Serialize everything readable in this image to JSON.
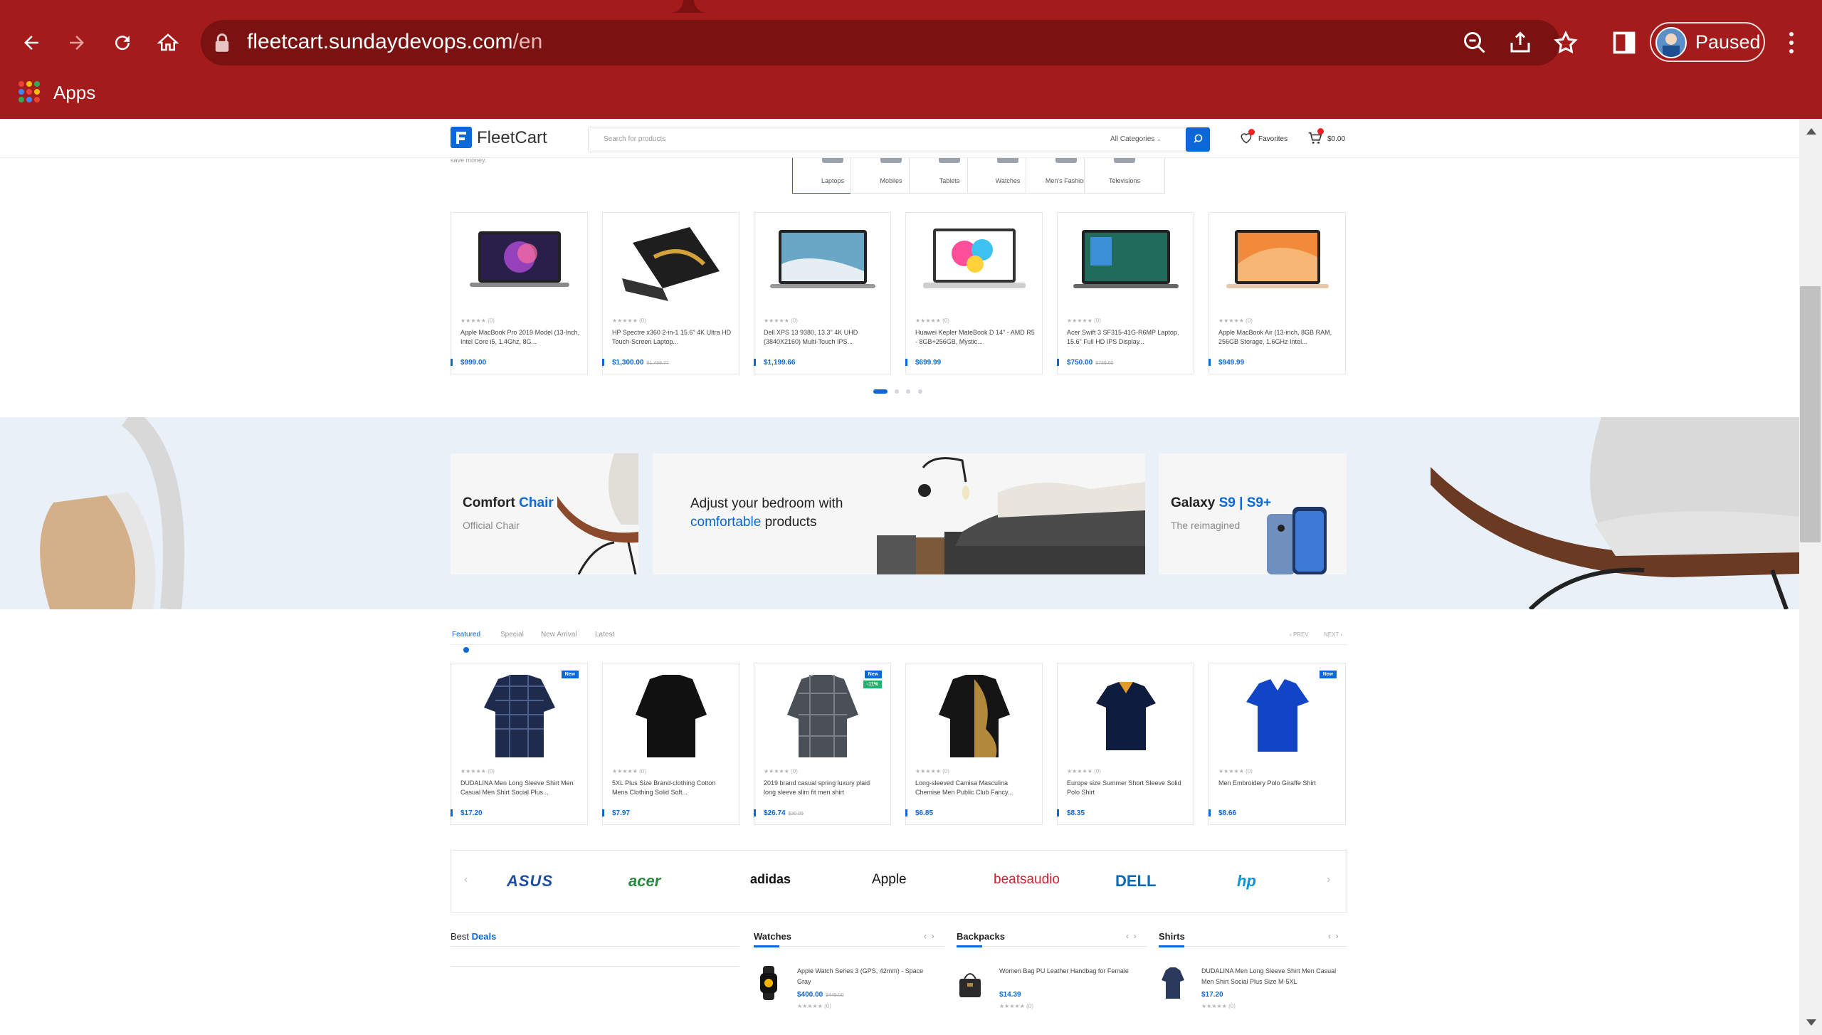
{
  "browser": {
    "url_host": "fleetcart.sundaydevops.com",
    "url_path": "/en",
    "profile_label": "Paused",
    "bookmarks_apps": "Apps",
    "theme_color": "#a31b1b"
  },
  "header": {
    "logo_text": "FleetCart",
    "search_placeholder": "Search for products",
    "category_select": "All Categories",
    "favorites_label": "Favorites",
    "cart_total": "$0.00",
    "accent": "#0a68d8"
  },
  "category_tabs": {
    "subtitle": "save money.",
    "items": [
      "Laptops",
      "Mobiles",
      "Tablets",
      "Watches",
      "Men's Fashion",
      "Televisions"
    ],
    "active": "Laptops"
  },
  "laptops": [
    {
      "name": "Apple MacBook Pro 2019 Model (13-Inch, Intel Core i5, 1.4Ghz, 8G...",
      "price": "$999.00",
      "old_price": "",
      "rating": "★★★★★",
      "reviews": "(0)"
    },
    {
      "name": "HP Spectre x360 2-in-1 15.6\" 4K Ultra HD Touch-Screen Laptop...",
      "price": "$1,300.00",
      "old_price": "$1,499.77",
      "rating": "★★★★★",
      "reviews": "(0)"
    },
    {
      "name": "Dell XPS 13 9380, 13.3\" 4K UHD (3840X2160) Multi-Touch IPS...",
      "price": "$1,199.66",
      "old_price": "",
      "rating": "★★★★★",
      "reviews": "(0)"
    },
    {
      "name": "Huawei Kepler MateBook D 14\" - AMD R5 - 8GB+256GB, Mystic...",
      "price": "$699.99",
      "old_price": "",
      "rating": "★★★★★",
      "reviews": "(0)"
    },
    {
      "name": "Acer Swift 3 SF315-41G-R6MP Laptop, 15.6\" Full HD IPS Display...",
      "price": "$750.00",
      "old_price": "$789.00",
      "rating": "★★★★★",
      "reviews": "(0)"
    },
    {
      "name": "Apple MacBook Air (13-inch, 8GB RAM, 256GB Storage, 1.6GHz Intel...",
      "price": "$949.99",
      "old_price": "",
      "rating": "★★★★★",
      "reviews": "(0)"
    }
  ],
  "carousel_pages": 4,
  "banners": {
    "left": {
      "title_a": "Comfort",
      "title_b": "Chair",
      "subtitle": "Official Chair"
    },
    "center": {
      "line1": "Adjust your bedroom with",
      "line2_a": "comfortable",
      "line2_b": "products"
    },
    "right": {
      "title_a": "Galaxy",
      "title_b": "S9 | S9+",
      "subtitle": "The reimagined"
    }
  },
  "featured_tabs": {
    "items": [
      "Featured",
      "Special",
      "New Arrival",
      "Latest"
    ],
    "active": "Featured",
    "prev": "‹ PREV",
    "next": "NEXT ›"
  },
  "shirts": [
    {
      "name": "DUDALINA Men Long Sleeve Shirt Men Casual Men Shirt Social Plus...",
      "price": "$17.20",
      "old_price": "",
      "tag_new": "New",
      "tag_off": "",
      "rating": "★★★★★",
      "reviews": "(0)"
    },
    {
      "name": "5XL Plus Size Brand-clothing Cotton Mens Clothing Solid Soft...",
      "price": "$7.97",
      "old_price": "",
      "tag_new": "",
      "tag_off": "",
      "rating": "★★★★★",
      "reviews": "(0)"
    },
    {
      "name": "2019 brand casual spring luxury plaid long sleeve slim fit men shirt",
      "price": "$26.74",
      "old_price": "$30.05",
      "tag_new": "New",
      "tag_off": "-11%",
      "rating": "★★★★★",
      "reviews": "(0)"
    },
    {
      "name": "Long-sleeved Camisa Masculina Chemise Men Public Club Fancy...",
      "price": "$6.85",
      "old_price": "",
      "tag_new": "",
      "tag_off": "",
      "rating": "★★★★★",
      "reviews": "(0)"
    },
    {
      "name": "Europe size Summer Short Sleeve Solid Polo Shirt",
      "price": "$8.35",
      "old_price": "",
      "tag_new": "",
      "tag_off": "",
      "rating": "★★★★★",
      "reviews": "(0)"
    },
    {
      "name": "Men Embroidery Polo Giraffe Shirt",
      "price": "$8.66",
      "old_price": "",
      "tag_new": "New",
      "tag_off": "",
      "rating": "★★★★★",
      "reviews": "(0)"
    }
  ],
  "brands": [
    "ASUS",
    "acer",
    "adidas",
    "Apple",
    "beatsaudio",
    "DELL",
    "hp"
  ],
  "bottom": {
    "best_deals_a": "Best",
    "best_deals_b": "Deals",
    "watches": {
      "title": "Watches",
      "name": "Apple Watch Series 3 (GPS, 42mm) - Space Gray",
      "price": "$400.00",
      "old_price": "$449.00",
      "rating": "★★★★★",
      "reviews": "(0)"
    },
    "backpacks": {
      "title": "Backpacks",
      "name": "Women Bag PU Leather Handbag for Female",
      "price": "$14.39",
      "rating": "★★★★★",
      "reviews": "(0)"
    },
    "shirts": {
      "title": "Shirts",
      "name": "DUDALINA Men Long Sleeve Shirt Men Casual Men Shirt Social Plus Size M-5XL",
      "price": "$17.20",
      "rating": "★★★★★",
      "reviews": "(0)"
    }
  }
}
